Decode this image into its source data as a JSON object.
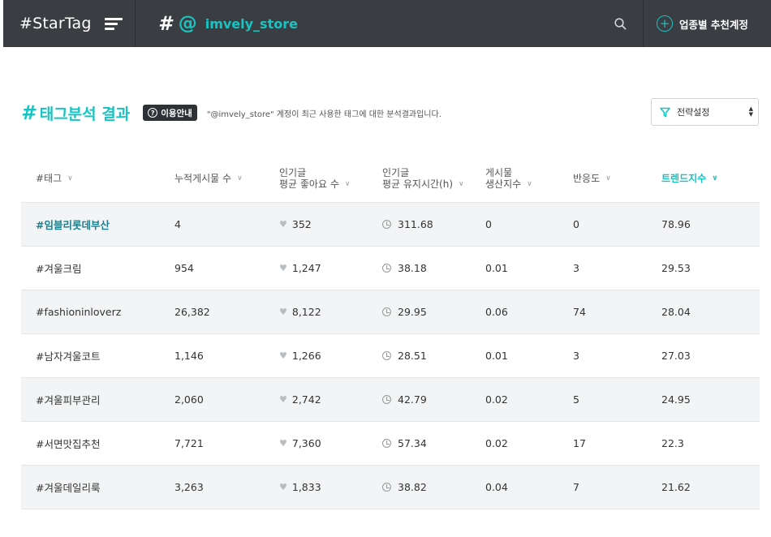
{
  "header": {
    "brand": "#StarTag",
    "hash_symbol": "#",
    "at_symbol": "@",
    "account": "imvely_store",
    "recommend_label": "업종별 추천계정"
  },
  "title": {
    "hash_symbol": "#",
    "text": "태그분석 결과",
    "guide_label": "이용안내",
    "guide_icon": "?",
    "description": "\"@imvely_store\" 계정이 최근 사용한 태그에 대한 분석결과입니다."
  },
  "strategy": {
    "label": "전략설정"
  },
  "table": {
    "columns": [
      {
        "line1": "#태그",
        "line2": ""
      },
      {
        "line1": "누적게시물 수",
        "line2": ""
      },
      {
        "line1": "인기글",
        "line2": "평균 좋아요 수"
      },
      {
        "line1": "인기글",
        "line2": "평균 유지시간(h)"
      },
      {
        "line1": "게시물",
        "line2": "생산지수"
      },
      {
        "line1": "반응도",
        "line2": ""
      },
      {
        "line1": "트렌드지수",
        "line2": ""
      }
    ],
    "rows": [
      {
        "tag": "#임블리롯데부산",
        "posts": "4",
        "likes": "352",
        "hours": "311.68",
        "production": "0",
        "reaction": "0",
        "trend": "78.96"
      },
      {
        "tag": "#겨울크림",
        "posts": "954",
        "likes": "1,247",
        "hours": "38.18",
        "production": "0.01",
        "reaction": "3",
        "trend": "29.53"
      },
      {
        "tag": "#fashioninloverz",
        "posts": "26,382",
        "likes": "8,122",
        "hours": "29.95",
        "production": "0.06",
        "reaction": "74",
        "trend": "28.04"
      },
      {
        "tag": "#남자겨울코트",
        "posts": "1,146",
        "likes": "1,266",
        "hours": "28.51",
        "production": "0.01",
        "reaction": "3",
        "trend": "27.03"
      },
      {
        "tag": "#겨울피부관리",
        "posts": "2,060",
        "likes": "2,742",
        "hours": "42.79",
        "production": "0.02",
        "reaction": "5",
        "trend": "24.95"
      },
      {
        "tag": "#서면맛집추천",
        "posts": "7,721",
        "likes": "7,360",
        "hours": "57.34",
        "production": "0.02",
        "reaction": "17",
        "trend": "22.3"
      },
      {
        "tag": "#겨울데일리룩",
        "posts": "3,263",
        "likes": "1,833",
        "hours": "38.82",
        "production": "0.04",
        "reaction": "7",
        "trend": "21.62"
      }
    ]
  },
  "colors": {
    "accent": "#19c3c2",
    "nav_bg": "#3a3e43",
    "row_shade": "#f3f4f5"
  },
  "icons": {
    "menu": "hamburger-icon",
    "search": "search-icon",
    "add": "plus-circle-icon",
    "filter": "filter-icon",
    "heart": "heart-icon",
    "clock": "clock-icon",
    "chevron": "chevron-down-icon"
  }
}
